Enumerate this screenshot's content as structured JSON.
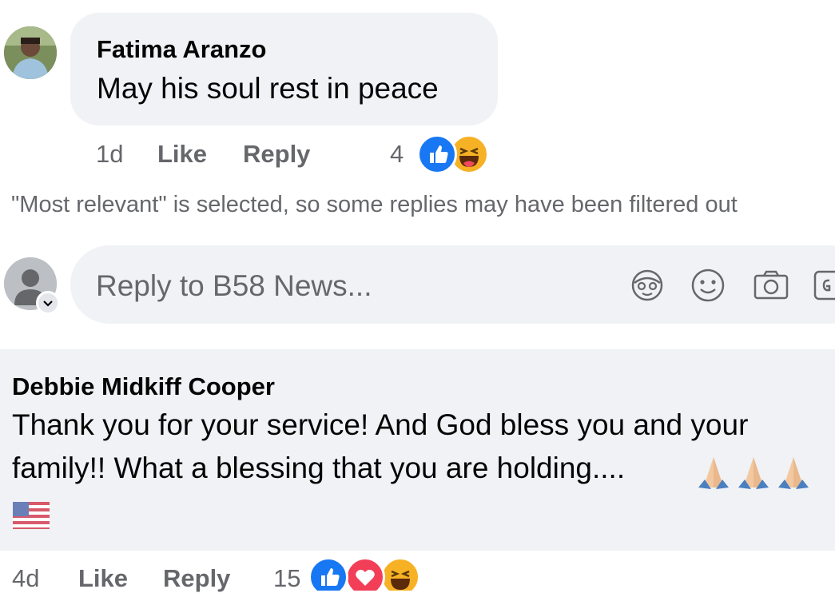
{
  "comment1": {
    "author": "Fatima Aranzo",
    "text": "May his soul rest in peace",
    "time": "1d",
    "like_label": "Like",
    "reply_label": "Reply",
    "reaction_count": "4",
    "reactions": [
      "like-icon",
      "haha-icon"
    ]
  },
  "notice": "\"Most relevant\" is selected, so some replies may have been filtered out",
  "composer": {
    "placeholder": "Reply to B58 News...",
    "icons": [
      "avatar-sticker-icon",
      "emoji-icon",
      "camera-icon",
      "gif-icon"
    ]
  },
  "comment2": {
    "author": "Debbie Midkiff Cooper",
    "line1": "Thank you for your service! And God bless you and your",
    "line2": "family!! What a blessing that you are holding....",
    "emoji_icons": [
      "folded-hands-icon",
      "folded-hands-icon",
      "folded-hands-icon",
      "us-flag-icon"
    ],
    "time": "4d",
    "like_label": "Like",
    "reply_label": "Reply",
    "reaction_count": "15",
    "reactions": [
      "like-icon",
      "love-icon",
      "haha-icon"
    ]
  },
  "colors": {
    "bubble": "#f0f2f5",
    "meta_text": "#65676b",
    "like_blue": "#1877f2",
    "love_red": "#f33e58",
    "haha_yellow": "#f7b125"
  }
}
